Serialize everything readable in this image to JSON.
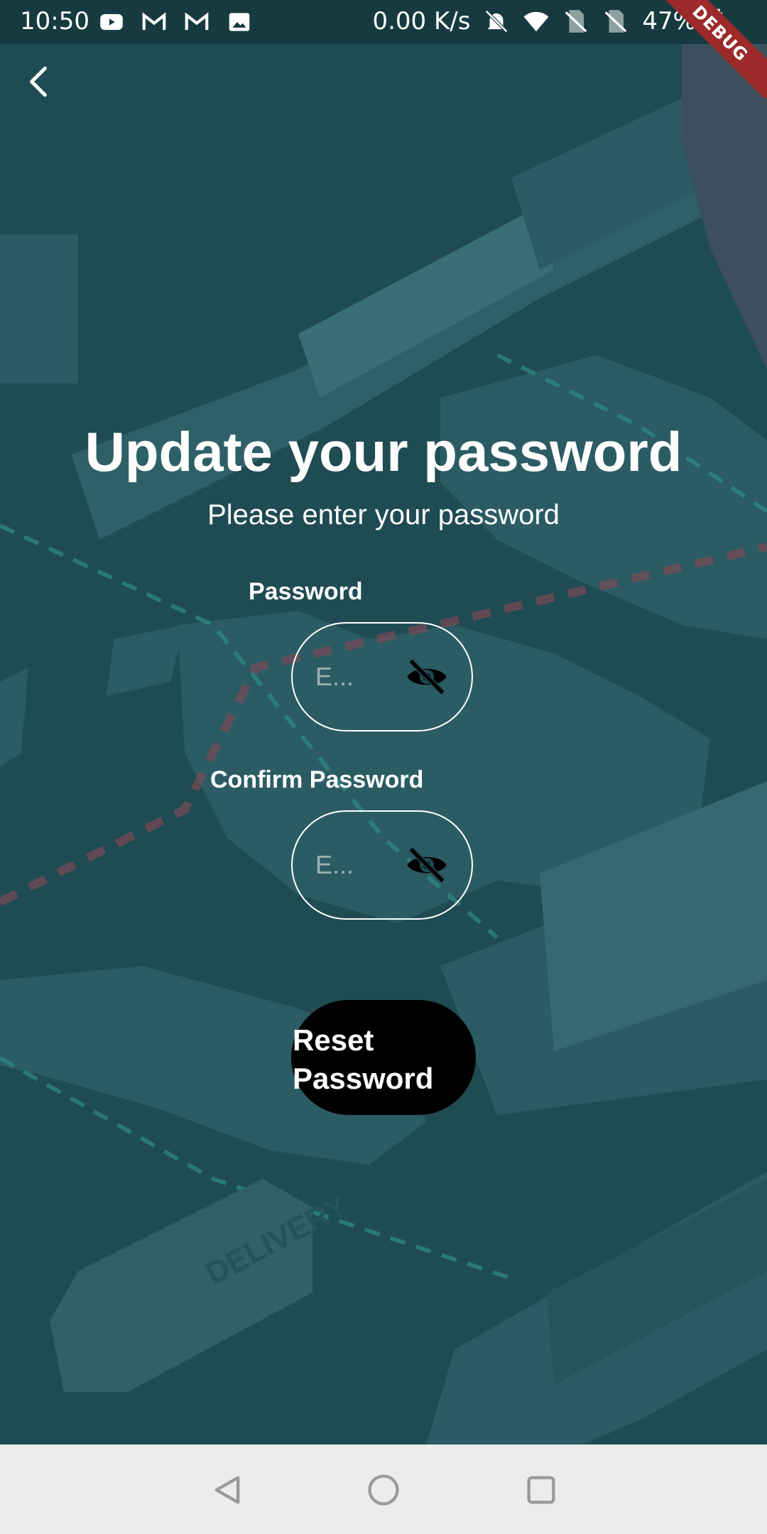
{
  "status_bar": {
    "time": "10:50",
    "speed": "0.00 K/s",
    "battery": "47%",
    "debug_label": "DEBUG",
    "icons_left": [
      "youtube-icon",
      "gmail-icon",
      "gmail-icon",
      "image-icon"
    ],
    "icons_right": [
      "mute-icon",
      "wifi-icon",
      "no-sim-icon",
      "no-sim-icon",
      "battery-icon"
    ]
  },
  "header": {
    "back_icon": "back-arrow-icon"
  },
  "main": {
    "title": "Update your password",
    "subtitle": "Please enter your password",
    "password": {
      "label": "Password",
      "placeholder": "E...",
      "value": ""
    },
    "confirm_password": {
      "label": "Confirm Password",
      "placeholder": "E...",
      "value": ""
    },
    "reset_button_label": "Reset Password"
  },
  "background": {
    "van_text": "DELIVERY"
  },
  "colors": {
    "background": "#1f4b52",
    "status_bar": "#163a40",
    "button": "#000000",
    "debug_ribbon": "#9c2a2a",
    "nav_bar": "#ececec"
  },
  "nav_bar": {
    "icons": [
      "back-triangle-icon",
      "home-circle-icon",
      "recents-square-icon"
    ]
  }
}
